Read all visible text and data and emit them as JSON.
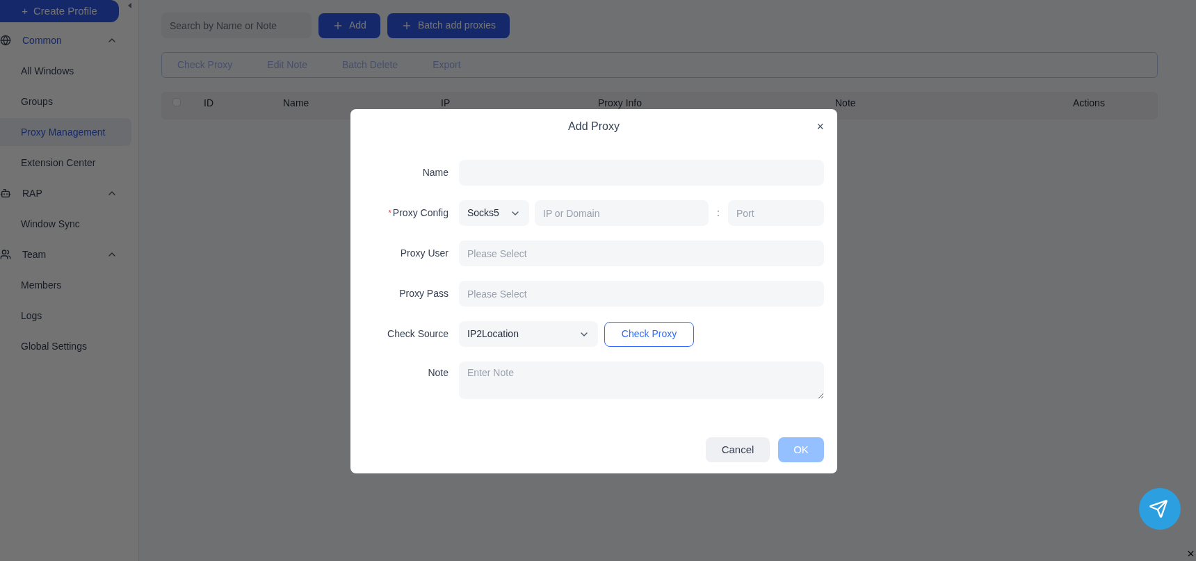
{
  "sidebar": {
    "create_button": {
      "icon": "+",
      "label": "Create Profile"
    },
    "groups": [
      {
        "label": "Common",
        "expanded": true,
        "selected": true,
        "children": [
          {
            "label": "All Windows",
            "selected": false
          },
          {
            "label": "Groups",
            "selected": false
          },
          {
            "label": "Proxy Management",
            "selected": true
          },
          {
            "label": "Extension Center",
            "selected": false
          }
        ]
      },
      {
        "label": "RAP",
        "expanded": true,
        "selected": false,
        "children": [
          {
            "label": "Window Sync",
            "selected": false
          }
        ]
      },
      {
        "label": "Team",
        "expanded": true,
        "selected": false,
        "children": [
          {
            "label": "Members",
            "selected": false
          },
          {
            "label": "Logs",
            "selected": false
          },
          {
            "label": "Global Settings",
            "selected": false
          }
        ]
      }
    ]
  },
  "toolbar": {
    "search": {
      "placeholder": "Search by Name or Note"
    },
    "buttons": [
      {
        "label": "Add"
      },
      {
        "label": "Batch add proxies"
      }
    ]
  },
  "actions": [
    {
      "label": "Check Proxy",
      "disabled": true
    },
    {
      "label": "Edit Note",
      "disabled": true
    },
    {
      "label": "Batch Delete",
      "disabled": true
    },
    {
      "label": "Export",
      "disabled": true
    }
  ],
  "table": {
    "select_all": {
      "checked": false
    },
    "columns": [
      "ID",
      "Name",
      "IP",
      "Proxy Info",
      "Note",
      "Actions"
    ]
  },
  "dialog": {
    "title": "Add Proxy",
    "close": "×",
    "required_mark": "*",
    "fields": [
      {
        "kind": "input",
        "label": "Name",
        "required": false
      },
      {
        "kind": "proxy",
        "label": "Proxy Config",
        "required": true,
        "type": "Socks5",
        "host_placeholder": "IP or Domain",
        "separator": ":",
        "port_placeholder": "Port"
      },
      {
        "kind": "input",
        "label": "Proxy User",
        "required": false,
        "placeholder": "Please Select"
      },
      {
        "kind": "input",
        "label": "Proxy Pass",
        "required": false,
        "placeholder": "Please Select"
      },
      {
        "kind": "source",
        "label": "Check Source",
        "required": false,
        "value": "IP2Location",
        "button": "Check Proxy"
      },
      {
        "kind": "textarea",
        "label": "Note",
        "required": false,
        "placeholder": "Enter Note"
      }
    ],
    "buttons": [
      {
        "label": "Cancel",
        "kind": "secondary",
        "disabled": false
      },
      {
        "label": "OK",
        "kind": "primary",
        "disabled": true
      }
    ]
  }
}
